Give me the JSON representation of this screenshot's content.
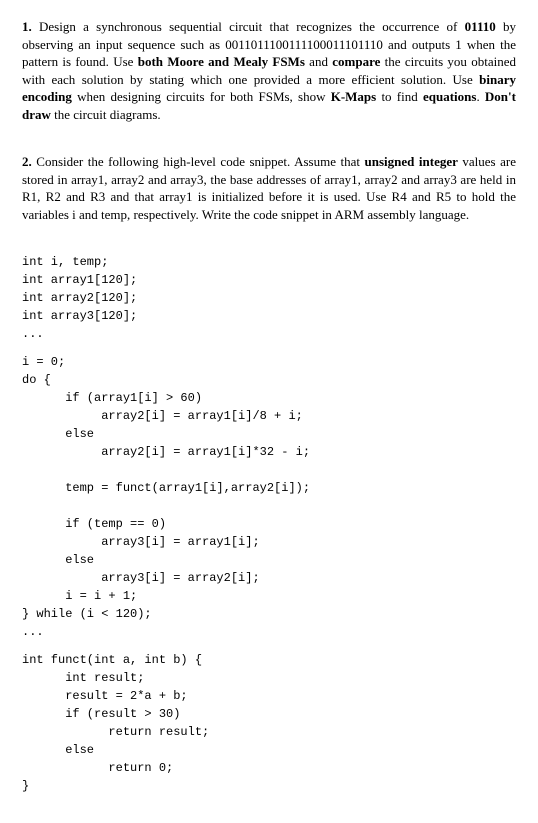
{
  "q1": {
    "num": "1.",
    "text_before_pattern": " Design a synchronous sequential circuit that recognizes the occurrence of ",
    "pattern": "01110",
    "text_after_pattern": " by observing an input sequence such as 0011011100111100011101110 and outputs 1 when the pattern is found. Use ",
    "both_fsms": "both Moore and Mealy FSMs",
    "text_and": " and ",
    "compare": "compare",
    "text_compare_tail": " the circuits you obtained with each solution by stating which one provided a more efficient solution. Use ",
    "binary_enc": "binary encoding",
    "text_binary_tail": " when designing circuits for both FSMs, show ",
    "kmaps": "K-Maps",
    "text_kmaps_tail": " to find ",
    "equations": "equations",
    "period": ". ",
    "dont_draw": "Don't draw",
    "text_dont_tail": " the circuit diagrams."
  },
  "q2": {
    "num": "2.",
    "text_a": " Consider the following high-level code snippet. Assume that ",
    "unsigned": "unsigned integer",
    "text_b": " values are stored in array1, array2 and array3, the base addresses of array1, array2 and array3 are held in R1, R2 and R3 and that array1 is initialized before it is used. Use R4 and R5 to hold the variables i and temp, respectively. Write the code snippet in ARM assembly language."
  },
  "code": {
    "decl": "int i, temp;\nint array1[120];\nint array2[120];\nint array3[120];\n...",
    "body": "i = 0;\ndo {\n      if (array1[i] > 60)\n           array2[i] = array1[i]/8 + i;\n      else\n           array2[i] = array1[i]*32 - i;\n\n      temp = funct(array1[i],array2[i]);\n\n      if (temp == 0)\n           array3[i] = array1[i];\n      else\n           array3[i] = array2[i];\n      i = i + 1;\n} while (i < 120);\n...",
    "fn": "int funct(int a, int b) {\n      int result;\n      result = 2*a + b;\n      if (result > 30)\n            return result;\n      else\n            return 0;\n}"
  }
}
